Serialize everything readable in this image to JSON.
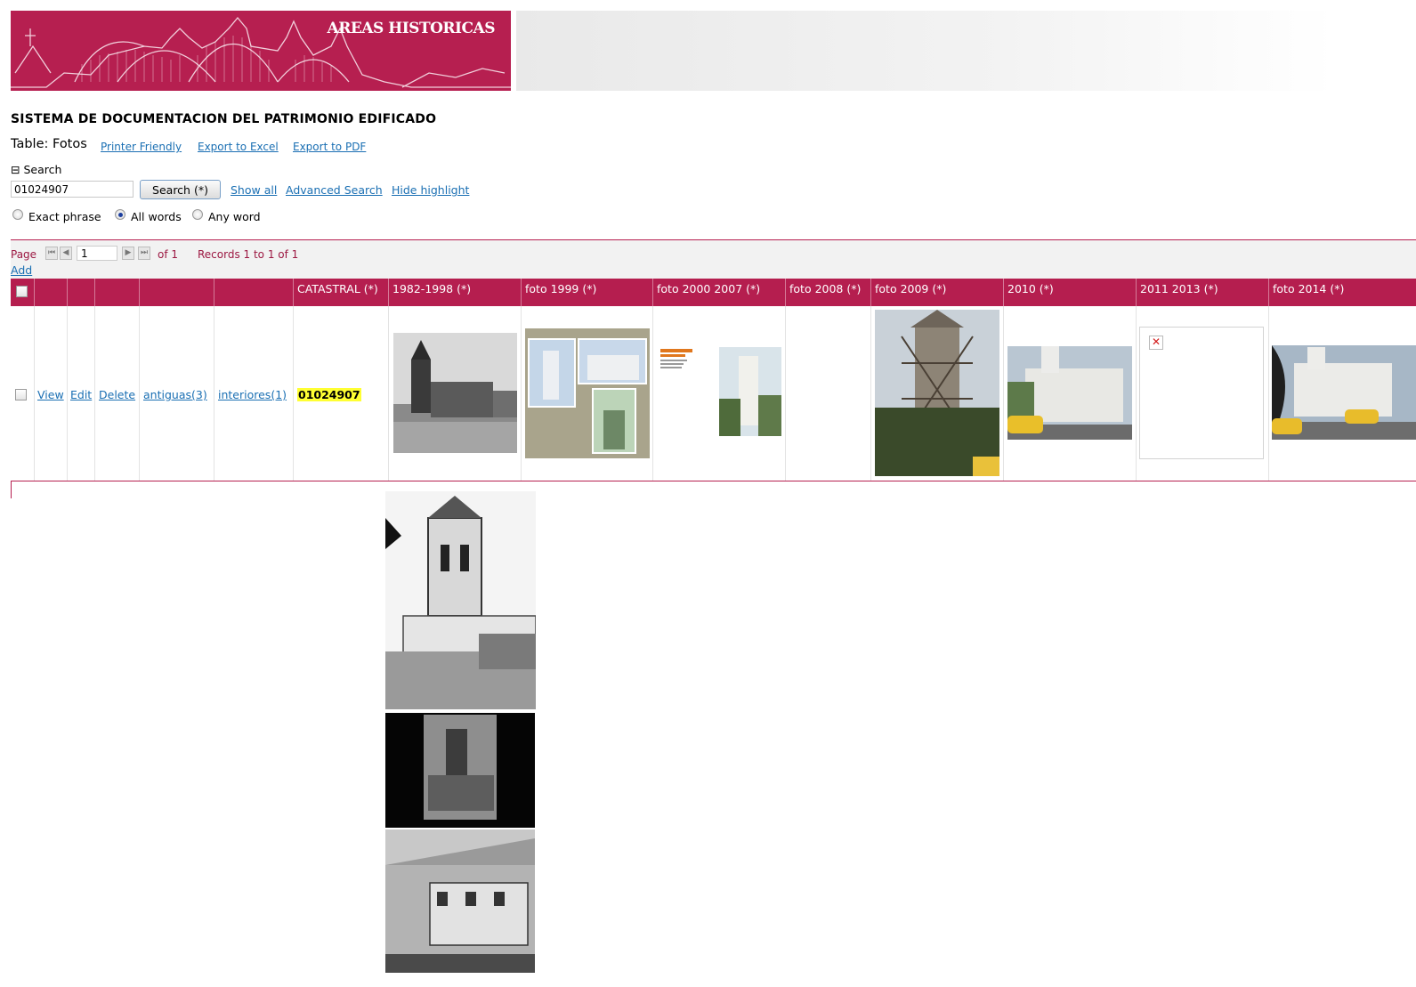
{
  "banner": {
    "title": "AREAS HISTORICAS"
  },
  "app_title": "SISTEMA DE DOCUMENTACION DEL PATRIMONIO EDIFICADO",
  "table_title": "Table: Fotos",
  "top_links": {
    "printer": "Printer Friendly",
    "excel": "Export to Excel",
    "pdf": "Export to PDF"
  },
  "search": {
    "toggle_label": "⊟ Search",
    "value": "01024907",
    "button": "Search (*)",
    "show_all": "Show all",
    "advanced": "Advanced Search",
    "hide_highlight": "Hide highlight",
    "options": [
      {
        "label": "Exact phrase",
        "selected": false
      },
      {
        "label": "All words",
        "selected": true
      },
      {
        "label": "Any word",
        "selected": false
      }
    ]
  },
  "pager": {
    "page_label": "Page",
    "page_value": "1",
    "of_label": "of 1",
    "records": "Records 1 to 1 of 1",
    "add": "Add"
  },
  "columns": [
    "",
    "",
    "",
    "",
    "",
    "",
    "CATASTRAL (*)",
    "1982-1998 (*)",
    "foto 1999 (*)",
    "foto 2000 2007 (*)",
    "foto 2008 (*)",
    "foto 2009 (*)",
    "2010 (*)",
    "2011 2013 (*)",
    "foto 2014 (*)"
  ],
  "row": {
    "view": "View",
    "edit": "Edit",
    "delete": "Delete",
    "antiguas": "antiguas(3)",
    "interiores": "interiores(1)",
    "catastral": "01024907"
  },
  "colors": {
    "accent": "#b61f50",
    "link": "#1a6fb3",
    "highlight": "#ffff33"
  },
  "icons": [
    "first-page-icon",
    "prev-page-icon",
    "next-page-icon",
    "last-page-icon",
    "broken-image-icon"
  ]
}
